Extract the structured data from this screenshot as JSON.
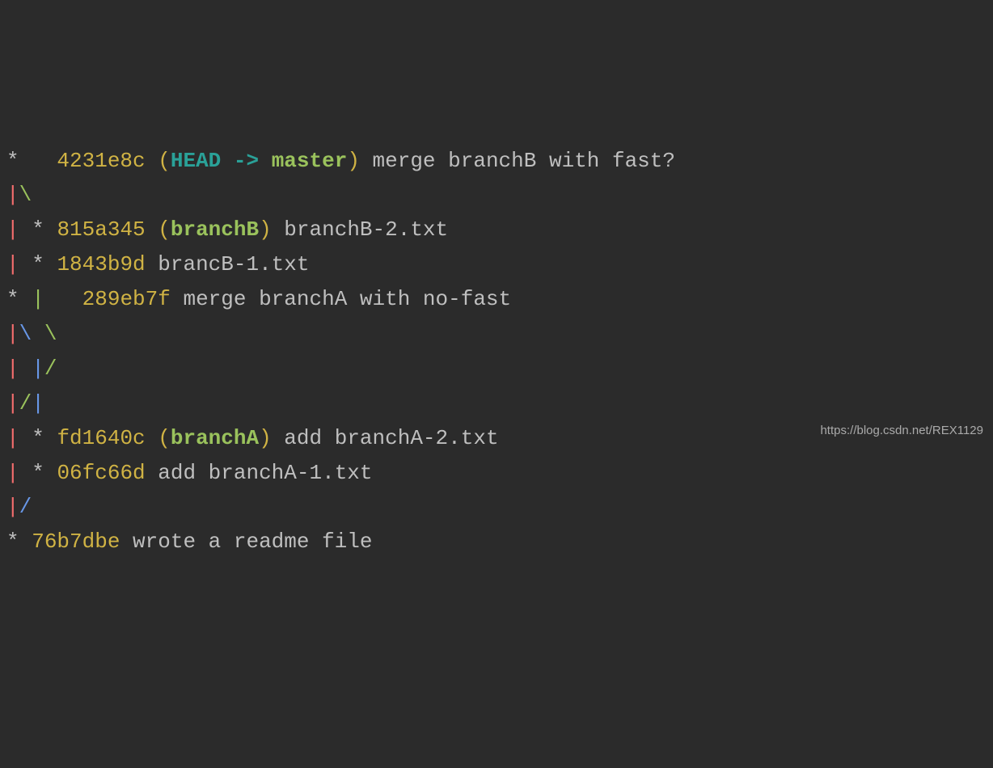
{
  "watermark": "https://blog.csdn.net/REX1129",
  "lines": [
    {
      "segments": [
        {
          "text": "*   ",
          "cls": "star"
        },
        {
          "text": "4231e8c ",
          "cls": "yellow"
        },
        {
          "text": "(",
          "cls": "yellow"
        },
        {
          "text": "HEAD -> ",
          "cls": "cyan"
        },
        {
          "text": "master",
          "cls": "master"
        },
        {
          "text": ")",
          "cls": "yellow"
        },
        {
          "text": " merge branchB with fast?",
          "cls": "msg"
        }
      ]
    },
    {
      "segments": [
        {
          "text": "|",
          "cls": "red"
        },
        {
          "text": "\\",
          "cls": "green"
        }
      ]
    },
    {
      "segments": [
        {
          "text": "| ",
          "cls": "red"
        },
        {
          "text": "* ",
          "cls": "star"
        },
        {
          "text": "815a345 ",
          "cls": "yellow"
        },
        {
          "text": "(",
          "cls": "yellow"
        },
        {
          "text": "branchB",
          "cls": "branch"
        },
        {
          "text": ")",
          "cls": "yellow"
        },
        {
          "text": " branchB-2.txt",
          "cls": "msg"
        }
      ]
    },
    {
      "segments": [
        {
          "text": "| ",
          "cls": "red"
        },
        {
          "text": "* ",
          "cls": "star"
        },
        {
          "text": "1843b9d",
          "cls": "yellow"
        },
        {
          "text": " brancB-1.txt",
          "cls": "msg"
        }
      ]
    },
    {
      "segments": [
        {
          "text": "* ",
          "cls": "star"
        },
        {
          "text": "|   ",
          "cls": "green"
        },
        {
          "text": "289eb7f",
          "cls": "yellow"
        },
        {
          "text": " merge branchA with no-fast",
          "cls": "msg"
        }
      ]
    },
    {
      "segments": [
        {
          "text": "|",
          "cls": "red"
        },
        {
          "text": "\\ ",
          "cls": "blue"
        },
        {
          "text": "\\",
          "cls": "green"
        }
      ]
    },
    {
      "segments": [
        {
          "text": "| ",
          "cls": "red"
        },
        {
          "text": "|",
          "cls": "blue"
        },
        {
          "text": "/",
          "cls": "green"
        }
      ]
    },
    {
      "segments": [
        {
          "text": "|",
          "cls": "red"
        },
        {
          "text": "/",
          "cls": "green"
        },
        {
          "text": "|",
          "cls": "blue"
        }
      ]
    },
    {
      "segments": [
        {
          "text": "| ",
          "cls": "red"
        },
        {
          "text": "* ",
          "cls": "star"
        },
        {
          "text": "fd1640c ",
          "cls": "yellow"
        },
        {
          "text": "(",
          "cls": "yellow"
        },
        {
          "text": "branchA",
          "cls": "branch"
        },
        {
          "text": ")",
          "cls": "yellow"
        },
        {
          "text": " add branchA-2.txt",
          "cls": "msg"
        }
      ]
    },
    {
      "segments": [
        {
          "text": "| ",
          "cls": "red"
        },
        {
          "text": "* ",
          "cls": "star"
        },
        {
          "text": "06fc66d",
          "cls": "yellow"
        },
        {
          "text": " add branchA-1.txt",
          "cls": "msg"
        }
      ]
    },
    {
      "segments": [
        {
          "text": "|",
          "cls": "red"
        },
        {
          "text": "/",
          "cls": "blue"
        }
      ]
    },
    {
      "segments": [
        {
          "text": "* ",
          "cls": "star"
        },
        {
          "text": "76b7dbe",
          "cls": "yellow"
        },
        {
          "text": " wrote a readme file",
          "cls": "msg"
        }
      ]
    }
  ]
}
